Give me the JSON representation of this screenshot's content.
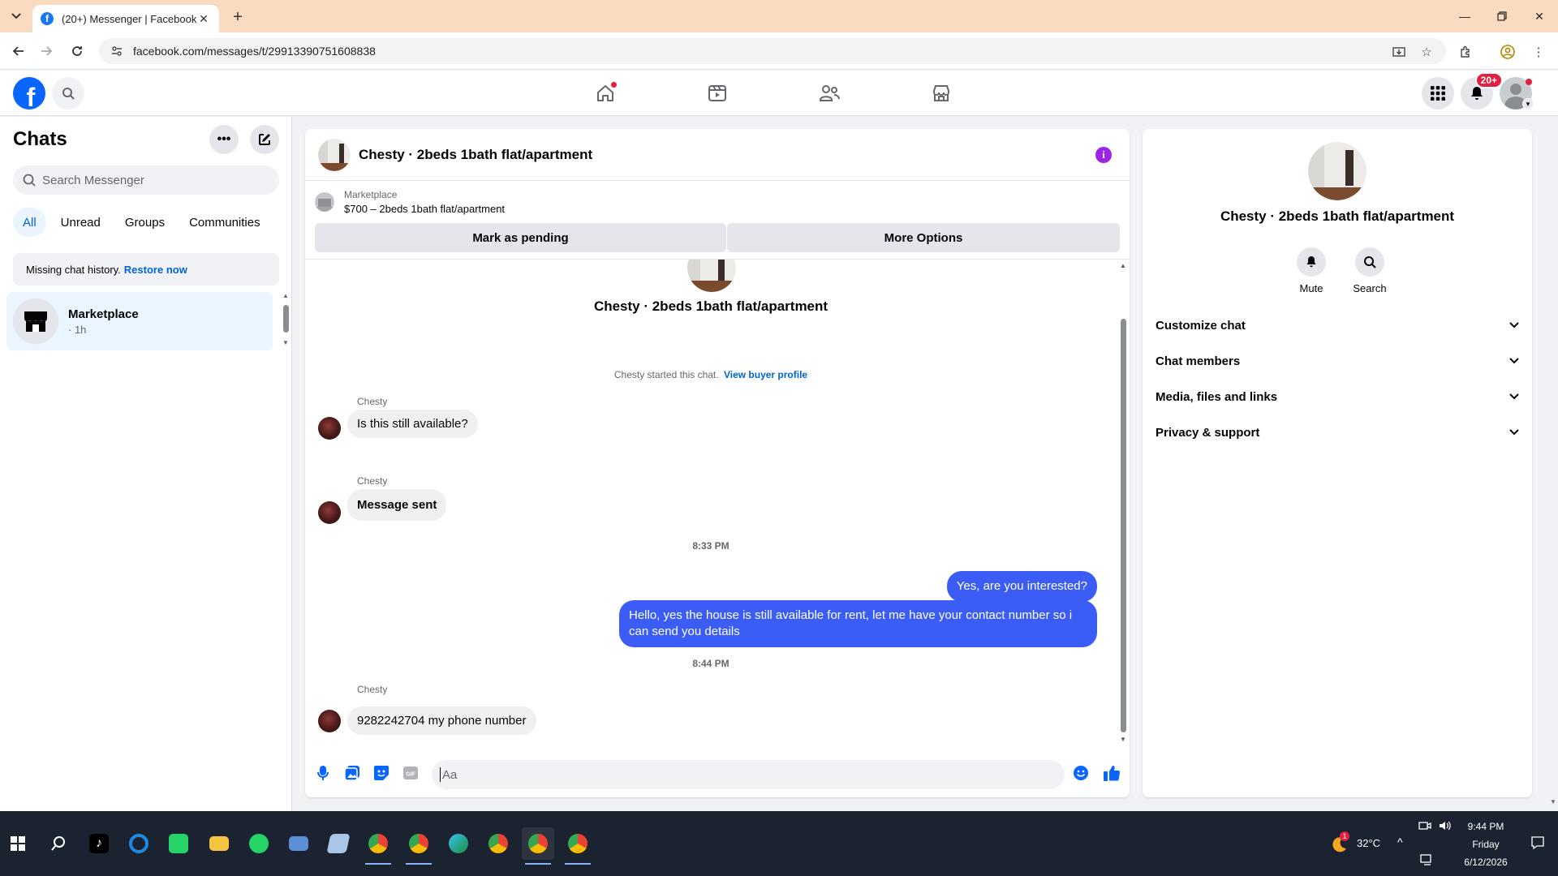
{
  "browser": {
    "tab_title": "(20+) Messenger | Facebook",
    "url": "facebook.com/messages/t/29913390751608838"
  },
  "header": {
    "notification_badge": "20+"
  },
  "sidebar": {
    "title": "Chats",
    "search_placeholder": "Search Messenger",
    "filters": [
      "All",
      "Unread",
      "Groups",
      "Communities"
    ],
    "active_filter": "All",
    "notice_text": "Missing chat history.",
    "notice_link": "Restore now",
    "chats": [
      {
        "name": "Marketplace",
        "time": "· 1h"
      }
    ]
  },
  "conversation": {
    "title": "Chesty · 2beds 1bath flat/apartment",
    "marketplace_label": "Marketplace",
    "listing": "$700 – 2beds 1bath flat/apartment",
    "mark_pending_label": "Mark as pending",
    "more_options_label": "More Options",
    "intro_name": "Chesty · 2beds 1bath flat/apartment",
    "started_text": "Chesty started this chat.",
    "view_profile_link": "View buyer profile",
    "messages": [
      {
        "sender": "Chesty",
        "text": "Is this still available?"
      },
      {
        "sender": "Chesty",
        "text": "Message sent"
      }
    ],
    "time_1": "8:33 PM",
    "outgoing": [
      "Yes, are you interested?",
      "Hello, yes the house is still available for rent, let me have your contact number so i can send you details"
    ],
    "time_2": "8:44 PM",
    "last_message": {
      "sender": "Chesty",
      "text": "9282242704  my phone number"
    },
    "composer_placeholder": "Aa"
  },
  "info_panel": {
    "name": "Chesty · 2beds 1bath flat/apartment",
    "mute_label": "Mute",
    "search_label": "Search",
    "sections": [
      "Customize chat",
      "Chat members",
      "Media, files and links",
      "Privacy & support"
    ]
  },
  "taskbar": {
    "temperature": "32°C",
    "weather_alert": "1",
    "time": "9:44 PM",
    "day": "Friday",
    "date": "6/12/2026"
  },
  "colors": {
    "tabbar": "#f9dcc0",
    "fb_blue": "#0866ff",
    "outgoing_bubble": "#3b5df5",
    "active_chat_bg": "#ebf5ff",
    "info_icon": "#9b23ea"
  }
}
